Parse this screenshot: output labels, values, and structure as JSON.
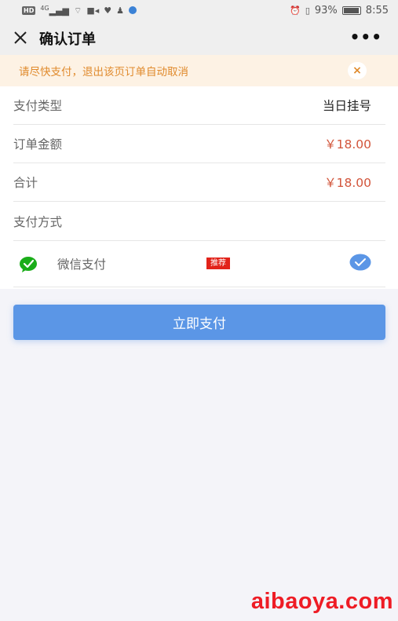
{
  "status_bar": {
    "hd": "HD",
    "network": "4G",
    "battery_text": "93%",
    "time": "8:55"
  },
  "nav": {
    "title": "确认订单",
    "more": "•••"
  },
  "notice": {
    "text": "请尽快支付，退出该页订单自动取消",
    "close": "×"
  },
  "rows": [
    {
      "label": "支付类型",
      "value": "当日挂号"
    },
    {
      "label": "订单金额",
      "value": "￥18.00"
    },
    {
      "label": "合计",
      "value": "￥18.00"
    },
    {
      "label": "支付方式",
      "value": ""
    }
  ],
  "payment": {
    "method_label": "微信支付",
    "badge": "推荐",
    "selected": true
  },
  "pay_button": {
    "label": "立即支付"
  },
  "watermark": "aibaoya.com",
  "colors": {
    "accent": "#5b96e6",
    "price": "#d2553b",
    "notice_text": "#e08a2c",
    "notice_bg": "#fdf2e4",
    "badge": "#e2231a",
    "wechat": "#1aad19"
  }
}
